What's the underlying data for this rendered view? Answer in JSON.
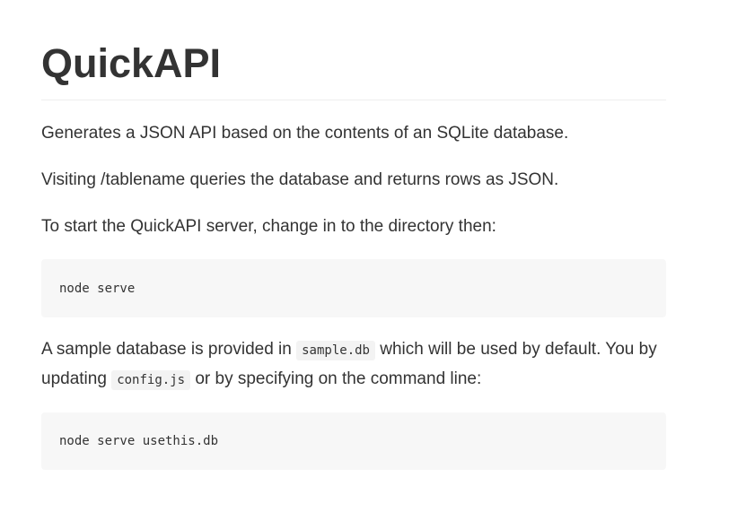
{
  "doc": {
    "title": "QuickAPI",
    "p1": "Generates a JSON API based on the contents of an SQLite database.",
    "p2": "Visiting /tablename queries the database and returns rows as JSON.",
    "p3": "To start the QuickAPI server, change in to the directory then:",
    "code1": "node serve",
    "p4": {
      "text_a": "A sample database is provided in ",
      "code_a": "sample.db",
      "text_b": " which will be used by default. You by updating ",
      "code_b": "config.js",
      "text_c": " or by specifying on the command line:"
    },
    "code2": "node serve usethis.db"
  }
}
